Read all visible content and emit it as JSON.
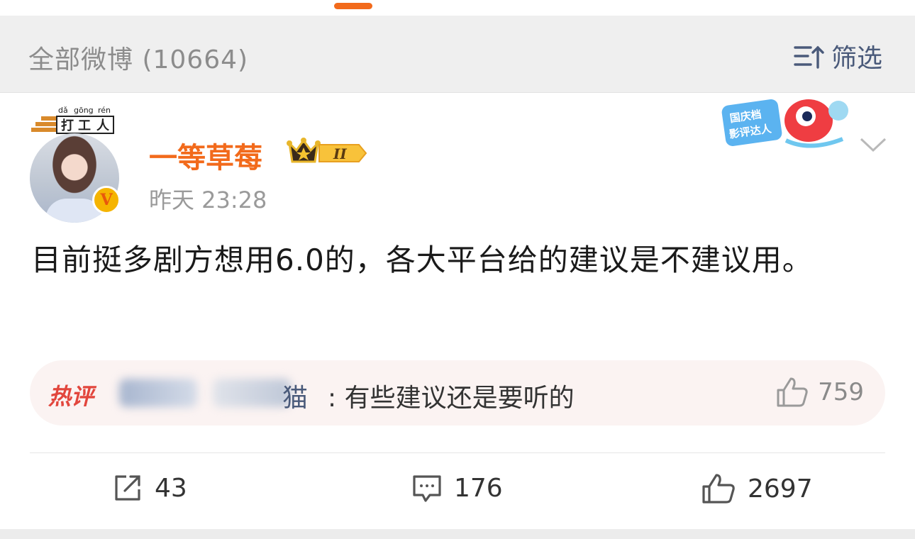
{
  "filter_bar": {
    "title": "全部微博 (10664)",
    "filter_label": "筛选"
  },
  "post": {
    "badge_pinyin": [
      "dǎ",
      "gōng",
      "rén"
    ],
    "badge_chars": [
      "打",
      "工",
      "人"
    ],
    "username": "一等草莓",
    "level": "II",
    "verify_mark": "V",
    "timestamp": "昨天 23:28",
    "promo_text": [
      "国庆档",
      "影评达人"
    ],
    "text": "目前挺多剧方想用6.0的，各大平台给的建议是不建议用。"
  },
  "hot_comment": {
    "label": "热评",
    "name_suffix": "猫",
    "text": ": 有些建议还是要听的",
    "likes": "759"
  },
  "actions": {
    "shares": "43",
    "comments": "176",
    "likes": "2697"
  },
  "colors": {
    "accent": "#f26a1b",
    "link": "#4a5a7a",
    "hot": "#e2463d"
  }
}
